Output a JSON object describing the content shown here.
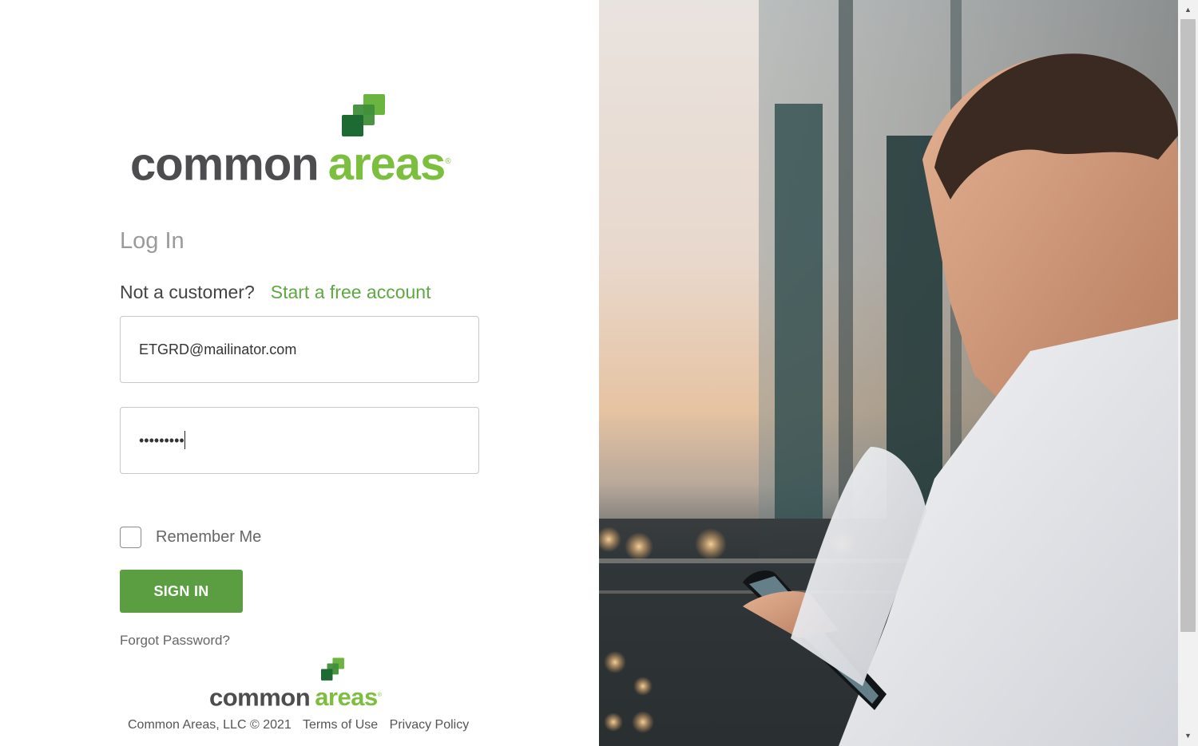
{
  "brand": {
    "word_common": "common",
    "word_areas": "areas",
    "registered_mark": "®",
    "colors": {
      "dark": "#4d4d4f",
      "green": "#7cbf3f",
      "button": "#5b9e42",
      "link": "#5ea843"
    }
  },
  "login": {
    "title": "Log In",
    "not_customer": "Not a customer?",
    "free_account_link": "Start a free account",
    "email_value": "ETGRD@mailinator.com",
    "password_value": "•••••••••",
    "remember_label": "Remember Me",
    "remember_checked": false,
    "sign_in_label": "SIGN IN",
    "forgot_password": "Forgot Password?"
  },
  "footer": {
    "copyright": "Common Areas, LLC © 2021",
    "terms": "Terms of Use",
    "privacy": "Privacy Policy"
  },
  "scrollbar": {
    "up_icon": "▲",
    "down_icon": "▼"
  }
}
